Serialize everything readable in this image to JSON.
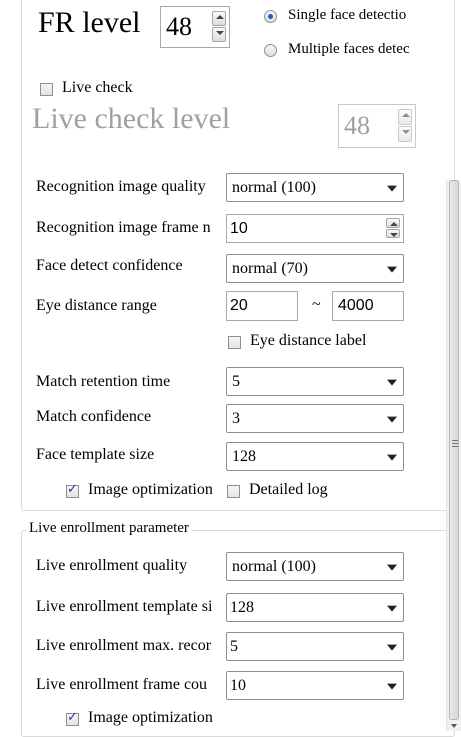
{
  "fr_level": {
    "label": "FR level",
    "value": "48"
  },
  "detection_mode": {
    "options": [
      {
        "label": "Single face detectio",
        "selected": true
      },
      {
        "label": "Multiple faces detec",
        "selected": false
      }
    ]
  },
  "live_check": {
    "label": "Live check",
    "checked": false
  },
  "live_check_level": {
    "label": "Live check level",
    "value": "48"
  },
  "recognition": {
    "image_quality": {
      "label": "Recognition image quality",
      "value": "normal (100)"
    },
    "frame_num": {
      "label": "Recognition image frame n",
      "value": "10"
    },
    "face_detect_confidence": {
      "label": "Face detect confidence",
      "value": "normal (70)"
    },
    "eye_distance_range": {
      "label": "Eye distance range",
      "min": "20",
      "sep": "~",
      "max": "4000"
    },
    "eye_distance_label": {
      "label": "Eye distance label",
      "checked": false
    },
    "match_retention_time": {
      "label": "Match retention time",
      "value": "5"
    },
    "match_confidence": {
      "label": "Match confidence",
      "value": "3"
    },
    "face_template_size": {
      "label": "Face template size",
      "value": "128"
    },
    "image_optimization": {
      "label": "Image optimization",
      "checked": true
    },
    "detailed_log": {
      "label": "Detailed log",
      "checked": false
    }
  },
  "live_enrollment": {
    "group_title": "Live enrollment parameter",
    "quality": {
      "label": "Live enrollment quality",
      "value": "normal (100)"
    },
    "template_size": {
      "label": "Live enrollment template si",
      "value": "128"
    },
    "max_records": {
      "label": "Live enrollment max. recor",
      "value": "5"
    },
    "frame_count": {
      "label": "Live enrollment frame cou",
      "value": "10"
    },
    "image_optimization": {
      "label": "Image optimization",
      "checked": true
    }
  },
  "colors": {
    "disabled_text": "#a0a0a0",
    "group_border": "#d9d9d9",
    "radio_dot": "#1e5bb8"
  }
}
